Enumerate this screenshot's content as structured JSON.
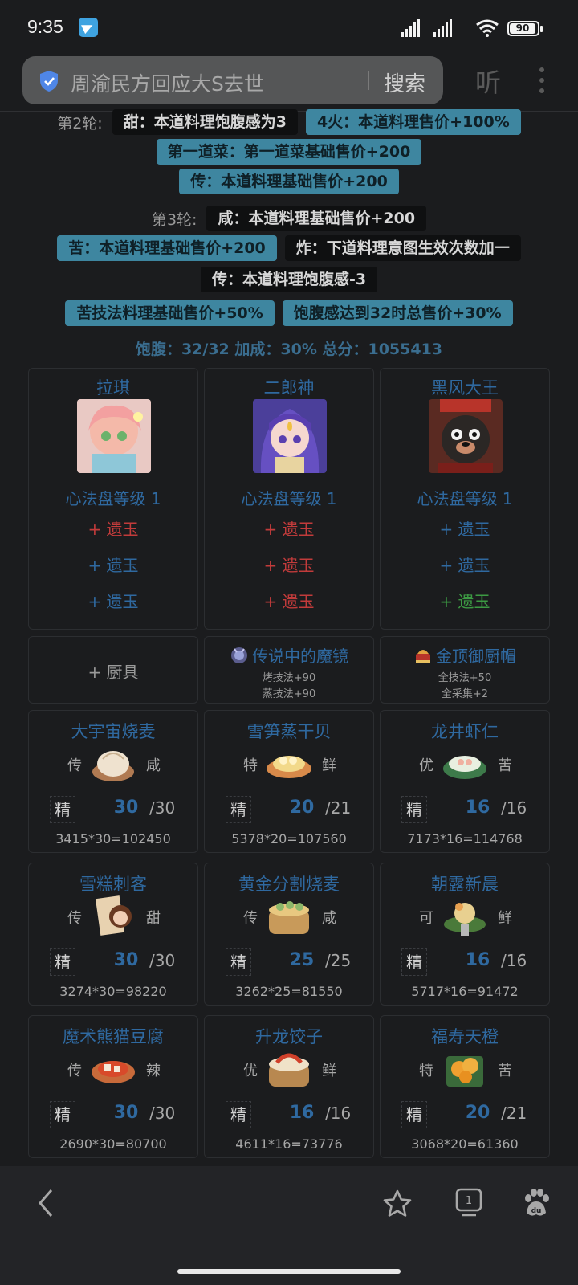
{
  "status": {
    "time": "9:35",
    "battery": "90"
  },
  "browser": {
    "search_query": "周渝民方回应大S去世",
    "search_button": "搜索",
    "listen": "听"
  },
  "rounds": [
    {
      "label": "第2轮:",
      "tags": [
        "甜：本道料理饱腹感为3",
        "4火：本道料理售价+100%",
        "第一道菜：第一道菜基础售价+200",
        "传：本道料理基础售价+200"
      ]
    },
    {
      "label": "第3轮:",
      "tags": [
        "咸：本道料理基础售价+200",
        "苦：本道料理基础售价+200",
        "炸：下道料理意图生效次数加一",
        "传：本道料理饱腹感-3"
      ]
    }
  ],
  "bonuses": [
    "苦技法料理基础售价+50%",
    "饱腹感达到32时总售价+30%"
  ],
  "summary": "饱腹：32/32 加成：30% 总分：1055413",
  "chefs": [
    {
      "name": "拉琪",
      "level": "心法盘等级 1",
      "slots": [
        {
          "text": "+ 遗玉",
          "color": "red"
        },
        {
          "text": "+ 遗玉",
          "color": "blue"
        },
        {
          "text": "+ 遗玉",
          "color": "blue"
        }
      ]
    },
    {
      "name": "二郎神",
      "level": "心法盘等级 1",
      "slots": [
        {
          "text": "+ 遗玉",
          "color": "red"
        },
        {
          "text": "+ 遗玉",
          "color": "red"
        },
        {
          "text": "+ 遗玉",
          "color": "red"
        }
      ]
    },
    {
      "name": "黑风大王",
      "level": "心法盘等级 1",
      "slots": [
        {
          "text": "+ 遗玉",
          "color": "blue"
        },
        {
          "text": "+ 遗玉",
          "color": "blue"
        },
        {
          "text": "+ 遗玉",
          "color": "green"
        }
      ]
    }
  ],
  "equipment": [
    {
      "add_label": "+ 厨具"
    },
    {
      "name": "传说中的魔镜",
      "lines": [
        "烤技法+90",
        "蒸技法+90"
      ]
    },
    {
      "name": "金顶御厨帽",
      "lines": [
        "全技法+50",
        "全采集+2"
      ]
    }
  ],
  "dishes": [
    {
      "name": "大宇宙烧麦",
      "rank": "传",
      "flavor": "咸",
      "grade": "精",
      "qty": "30",
      "max": "/30",
      "score": "3415*30=102450"
    },
    {
      "name": "雪笋蒸干贝",
      "rank": "特",
      "flavor": "鲜",
      "grade": "精",
      "qty": "20",
      "max": "/21",
      "score": "5378*20=107560"
    },
    {
      "name": "龙井虾仁",
      "rank": "优",
      "flavor": "苦",
      "grade": "精",
      "qty": "16",
      "max": "/16",
      "score": "7173*16=114768"
    },
    {
      "name": "雪糕刺客",
      "rank": "传",
      "flavor": "甜",
      "grade": "精",
      "qty": "30",
      "max": "/30",
      "score": "3274*30=98220"
    },
    {
      "name": "黄金分割烧麦",
      "rank": "传",
      "flavor": "咸",
      "grade": "精",
      "qty": "25",
      "max": "/25",
      "score": "3262*25=81550"
    },
    {
      "name": "朝露新晨",
      "rank": "可",
      "flavor": "鲜",
      "grade": "精",
      "qty": "16",
      "max": "/16",
      "score": "5717*16=91472"
    },
    {
      "name": "魔术熊猫豆腐",
      "rank": "传",
      "flavor": "辣",
      "grade": "精",
      "qty": "30",
      "max": "/30",
      "score": "2690*30=80700"
    },
    {
      "name": "升龙饺子",
      "rank": "优",
      "flavor": "鲜",
      "grade": "精",
      "qty": "16",
      "max": "/16",
      "score": "4611*16=73776"
    },
    {
      "name": "福寿天橙",
      "rank": "特",
      "flavor": "苦",
      "grade": "精",
      "qty": "20",
      "max": "/21",
      "score": "3068*20=61360"
    }
  ],
  "colors": {
    "accent_blue": "#2f69a0",
    "tag_blue": "#3e86a0",
    "red": "#c23b3b",
    "green": "#3c9a43"
  }
}
